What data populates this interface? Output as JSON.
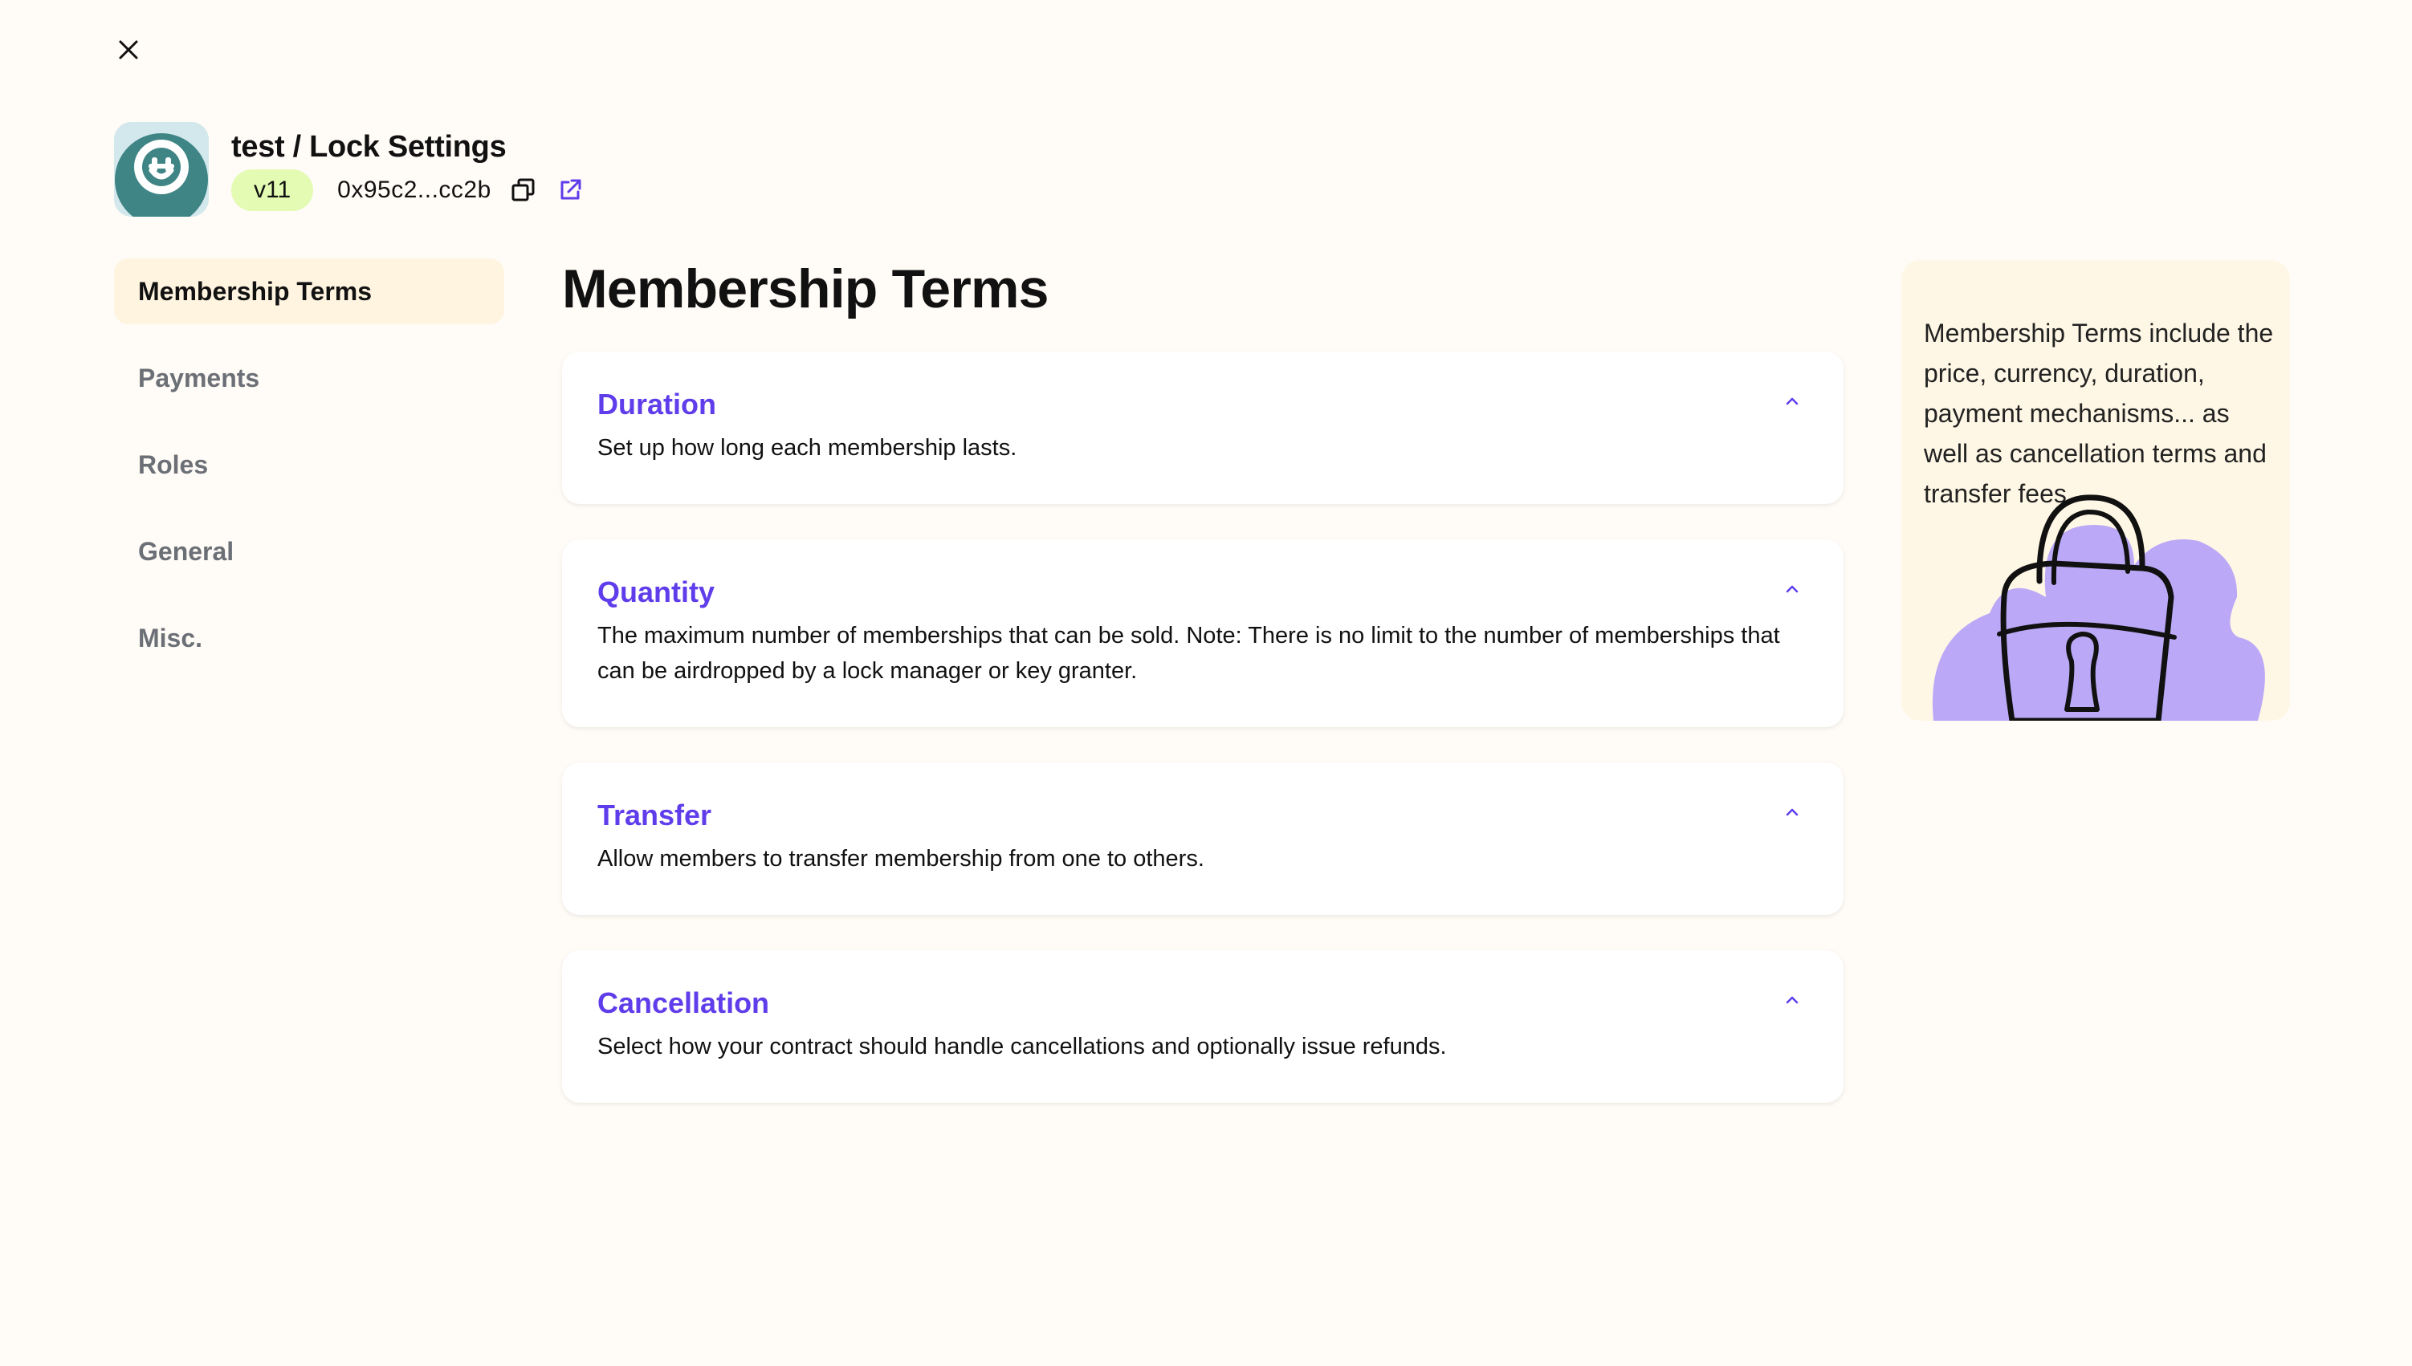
{
  "close": {
    "icon": "close-icon"
  },
  "header": {
    "title": "test / Lock Settings",
    "version": "v11",
    "address": "0x95c2...cc2b",
    "copy_icon": "copy-icon",
    "external_icon": "external-link-icon"
  },
  "sidebar": {
    "items": [
      {
        "label": "Membership Terms",
        "active": true
      },
      {
        "label": "Payments",
        "active": false
      },
      {
        "label": "Roles",
        "active": false
      },
      {
        "label": "General",
        "active": false
      },
      {
        "label": "Misc.",
        "active": false
      }
    ]
  },
  "main": {
    "title": "Membership Terms",
    "cards": [
      {
        "title": "Duration",
        "description": "Set up how long each membership lasts."
      },
      {
        "title": "Quantity",
        "description": "The maximum number of memberships that can be sold. Note: There is no limit to the number of memberships that can be airdropped by a lock manager or key granter."
      },
      {
        "title": "Transfer",
        "description": "Allow members to transfer membership from one to others."
      },
      {
        "title": "Cancellation",
        "description": "Select how your contract should handle cancellations and optionally issue refunds."
      }
    ]
  },
  "info": {
    "text": "Membership Terms include the price, currency, duration, payment mechanisms... as well as cancellation terms and transfer fees."
  },
  "colors": {
    "background": "#FFFBF6",
    "accent": "#603DEB",
    "version_badge": "#E3FBB3",
    "active_nav": "#FFF4E0",
    "info_panel": "#FFF7E5",
    "illustration": "#BBA9F7"
  }
}
